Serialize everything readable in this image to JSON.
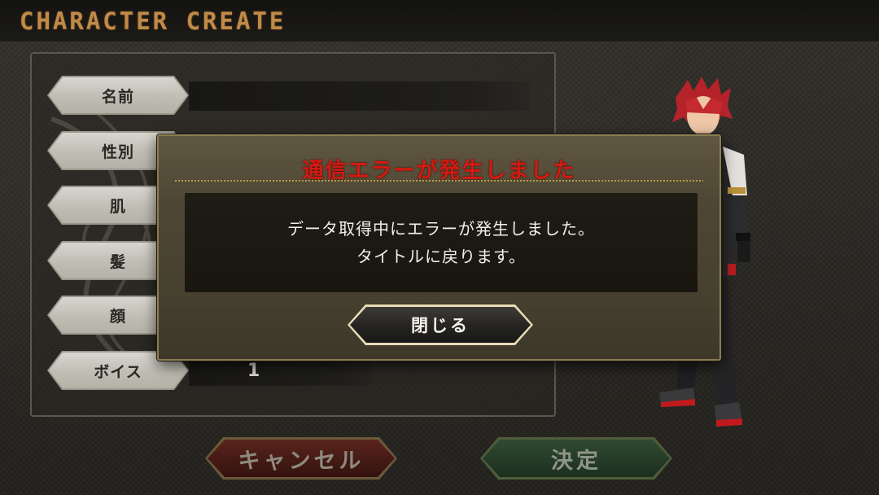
{
  "header": {
    "title": "CHARACTER CREATE"
  },
  "form": {
    "fields": [
      {
        "label": "名前",
        "value": ""
      },
      {
        "label": "性別",
        "value": ""
      },
      {
        "label": "肌",
        "value": ""
      },
      {
        "label": "髪",
        "value": ""
      },
      {
        "label": "顔",
        "value": ""
      },
      {
        "label": "ボイス",
        "value": "1"
      }
    ]
  },
  "dialog": {
    "title": "通信エラーが発生しました",
    "message_line1": "データ取得中にエラーが発生しました。",
    "message_line2": "タイトルに戻ります。",
    "close_label": "閉じる"
  },
  "footer": {
    "cancel_label": "キャンセル",
    "decide_label": "決定"
  },
  "colors": {
    "header_title": "#c08a48",
    "dialog_title": "#d41a12",
    "cancel_bg": "#441a14",
    "decide_bg": "#253b27"
  }
}
